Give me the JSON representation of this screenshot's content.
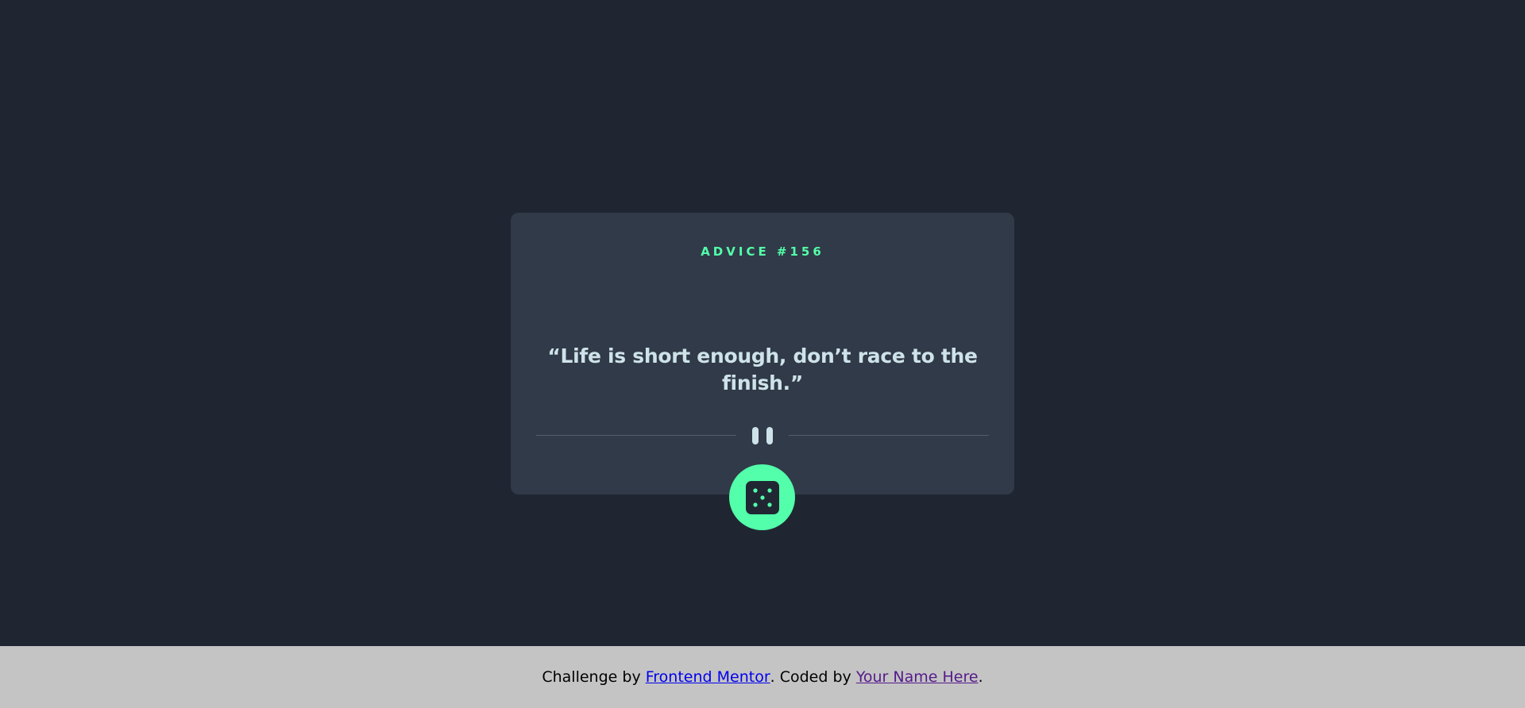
{
  "card": {
    "advice_id": "ADVICE #156",
    "advice_text": "“Life is short enough, don’t race to the finish.”",
    "divider_icon": "pause-icon",
    "dice_button_icon": "dice-icon"
  },
  "attribution": {
    "prefix": "Challenge by ",
    "frontend_mentor_link": "Frontend Mentor",
    "middle": ". Coded by ",
    "author_link": "Your Name Here",
    "suffix": "."
  },
  "colors": {
    "background": "#1f2632",
    "card": "#313a48",
    "accent_green": "#53ffaa",
    "text_light": "#cee3e9",
    "divider": "#4f5d74",
    "footer_bg": "#c4c4c4"
  }
}
